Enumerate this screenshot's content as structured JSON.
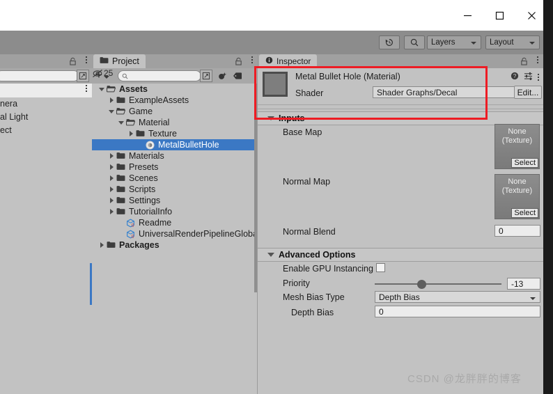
{
  "window": {
    "minimize_label": "Minimize",
    "maximize_label": "Maximize",
    "close_label": "Close"
  },
  "toolbar": {
    "history_icon": "undo-history-icon",
    "search_icon": "search-icon",
    "layers_label": "Layers",
    "layout_label": "Layout"
  },
  "hierarchy": {
    "search_placeholder": "",
    "items": [
      {
        "label": "nera"
      },
      {
        "label": "al Light"
      },
      {
        "label": "ect"
      }
    ]
  },
  "project": {
    "tab_label": "Project",
    "add_label": "+",
    "search_placeholder": "",
    "hidden_count": "25",
    "icons": {
      "folder": "folder-icon",
      "favorite": "favorites-icon",
      "tag": "tag-icon",
      "hidden": "visibility-off-icon",
      "lock": "lock-icon",
      "kebab": "kebab-menu-icon",
      "expand": "expand-search-icon"
    },
    "tree": [
      {
        "label": "Assets",
        "depth": 0,
        "twisty": "open",
        "icon": "folder-open",
        "bold": true,
        "selected": false
      },
      {
        "label": "ExampleAssets",
        "depth": 1,
        "twisty": "closed",
        "icon": "folder",
        "bold": false,
        "selected": false
      },
      {
        "label": "Game",
        "depth": 1,
        "twisty": "open",
        "icon": "folder-open",
        "bold": false,
        "selected": false
      },
      {
        "label": "Material",
        "depth": 2,
        "twisty": "open",
        "icon": "folder-open",
        "bold": false,
        "selected": false
      },
      {
        "label": "Texture",
        "depth": 3,
        "twisty": "closed",
        "icon": "folder",
        "bold": false,
        "selected": false
      },
      {
        "label": "MetalBulletHole",
        "depth": 4,
        "twisty": "none",
        "icon": "material-icon",
        "bold": false,
        "selected": true
      },
      {
        "label": "Materials",
        "depth": 1,
        "twisty": "closed",
        "icon": "folder",
        "bold": false,
        "selected": false
      },
      {
        "label": "Presets",
        "depth": 1,
        "twisty": "closed",
        "icon": "folder",
        "bold": false,
        "selected": false
      },
      {
        "label": "Scenes",
        "depth": 1,
        "twisty": "closed",
        "icon": "folder",
        "bold": false,
        "selected": false
      },
      {
        "label": "Scripts",
        "depth": 1,
        "twisty": "closed",
        "icon": "folder",
        "bold": false,
        "selected": false
      },
      {
        "label": "Settings",
        "depth": 1,
        "twisty": "closed",
        "icon": "folder",
        "bold": false,
        "selected": false
      },
      {
        "label": "TutorialInfo",
        "depth": 1,
        "twisty": "closed",
        "icon": "folder",
        "bold": false,
        "selected": false
      },
      {
        "label": "Readme",
        "depth": 2,
        "twisty": "none",
        "icon": "scriptable-object-icon",
        "bold": false,
        "selected": false
      },
      {
        "label": "UniversalRenderPipelineGlobalSe",
        "depth": 2,
        "twisty": "none",
        "icon": "scriptable-object-icon",
        "bold": false,
        "selected": false
      },
      {
        "label": "Packages",
        "depth": 0,
        "twisty": "closed",
        "icon": "folder",
        "bold": true,
        "selected": false
      }
    ]
  },
  "inspector": {
    "tab_label": "Inspector",
    "tab_icon": "info-icon",
    "lock_icon": "lock-icon",
    "kebab_icon": "kebab-menu-icon",
    "material": {
      "title": "Metal Bullet Hole (Material)",
      "help_icon": "help-icon",
      "preset_icon": "preset-settings-icon",
      "kebab_icon": "kebab-menu-icon",
      "shader_label": "Shader",
      "shader_value": "Shader Graphs/Decal",
      "edit_label": "Edit..."
    },
    "inputs": {
      "section_title": "Inputs",
      "base_map_label": "Base Map",
      "base_map_value_line1": "None",
      "base_map_value_line2": "(Texture)",
      "base_map_select_label": "Select",
      "normal_map_label": "Normal Map",
      "normal_map_value_line1": "None",
      "normal_map_value_line2": "(Texture)",
      "normal_map_select_label": "Select",
      "normal_blend_label": "Normal Blend",
      "normal_blend_value": "0"
    },
    "advanced": {
      "section_title": "Advanced Options",
      "gpu_instancing_label": "Enable GPU Instancing",
      "gpu_instancing_checked": false,
      "priority_label": "Priority",
      "priority_value": "-13",
      "mesh_bias_type_label": "Mesh Bias Type",
      "mesh_bias_type_value": "Depth Bias",
      "depth_bias_label": "Depth Bias",
      "depth_bias_value": "0"
    }
  },
  "annotation": {
    "highlight_color": "#ee1c24"
  },
  "watermark": {
    "text": "CSDN @龙胖胖的博客"
  }
}
